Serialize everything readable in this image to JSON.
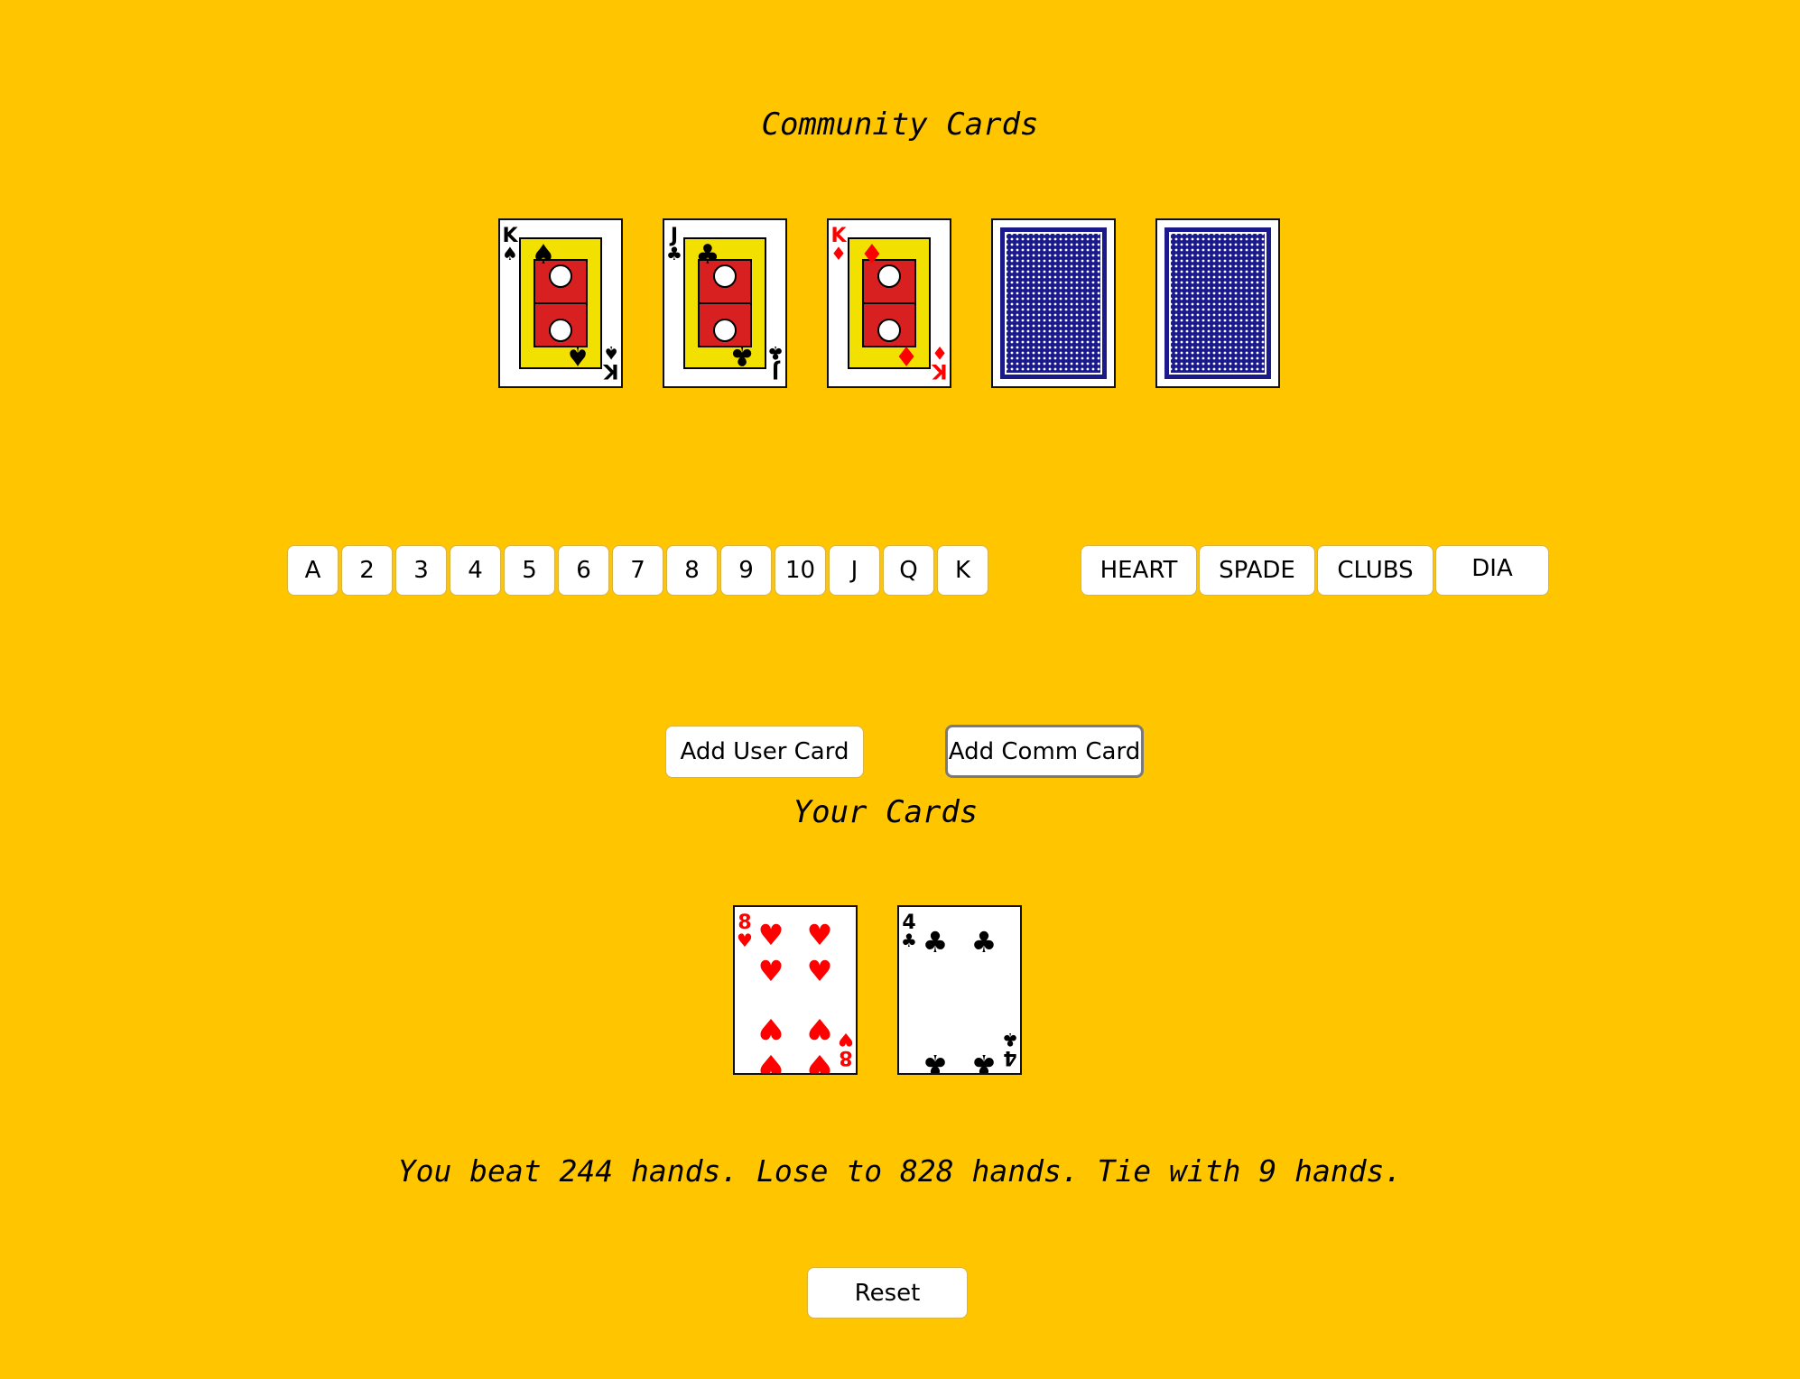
{
  "background_color": "#FFC600",
  "community": {
    "title": "Community Cards",
    "cards": [
      {
        "rank": "K",
        "suit": "spade",
        "face_up": true
      },
      {
        "rank": "J",
        "suit": "club",
        "face_up": true
      },
      {
        "rank": "K",
        "suit": "diamond",
        "face_up": true
      },
      {
        "face_up": false
      },
      {
        "face_up": false
      }
    ]
  },
  "rank_buttons": [
    "A",
    "2",
    "3",
    "4",
    "5",
    "6",
    "7",
    "8",
    "9",
    "10",
    "J",
    "Q",
    "K"
  ],
  "suit_buttons": [
    "HEART",
    "SPADE",
    "CLUBS",
    "DIA"
  ],
  "actions": {
    "add_user_card": "Add User Card",
    "add_comm_card": "Add Comm Card"
  },
  "user": {
    "title": "Your Cards",
    "cards": [
      {
        "rank": "8",
        "suit": "heart",
        "face_up": true
      },
      {
        "rank": "4",
        "suit": "club",
        "face_up": true
      }
    ]
  },
  "result_text": "You beat 244 hands. Lose to 828 hands. Tie with 9 hands.",
  "reset_label": "Reset",
  "colors": {
    "red_suit": "#FF0000",
    "black_suit": "#000000",
    "card_back": "#1A1A8C"
  }
}
